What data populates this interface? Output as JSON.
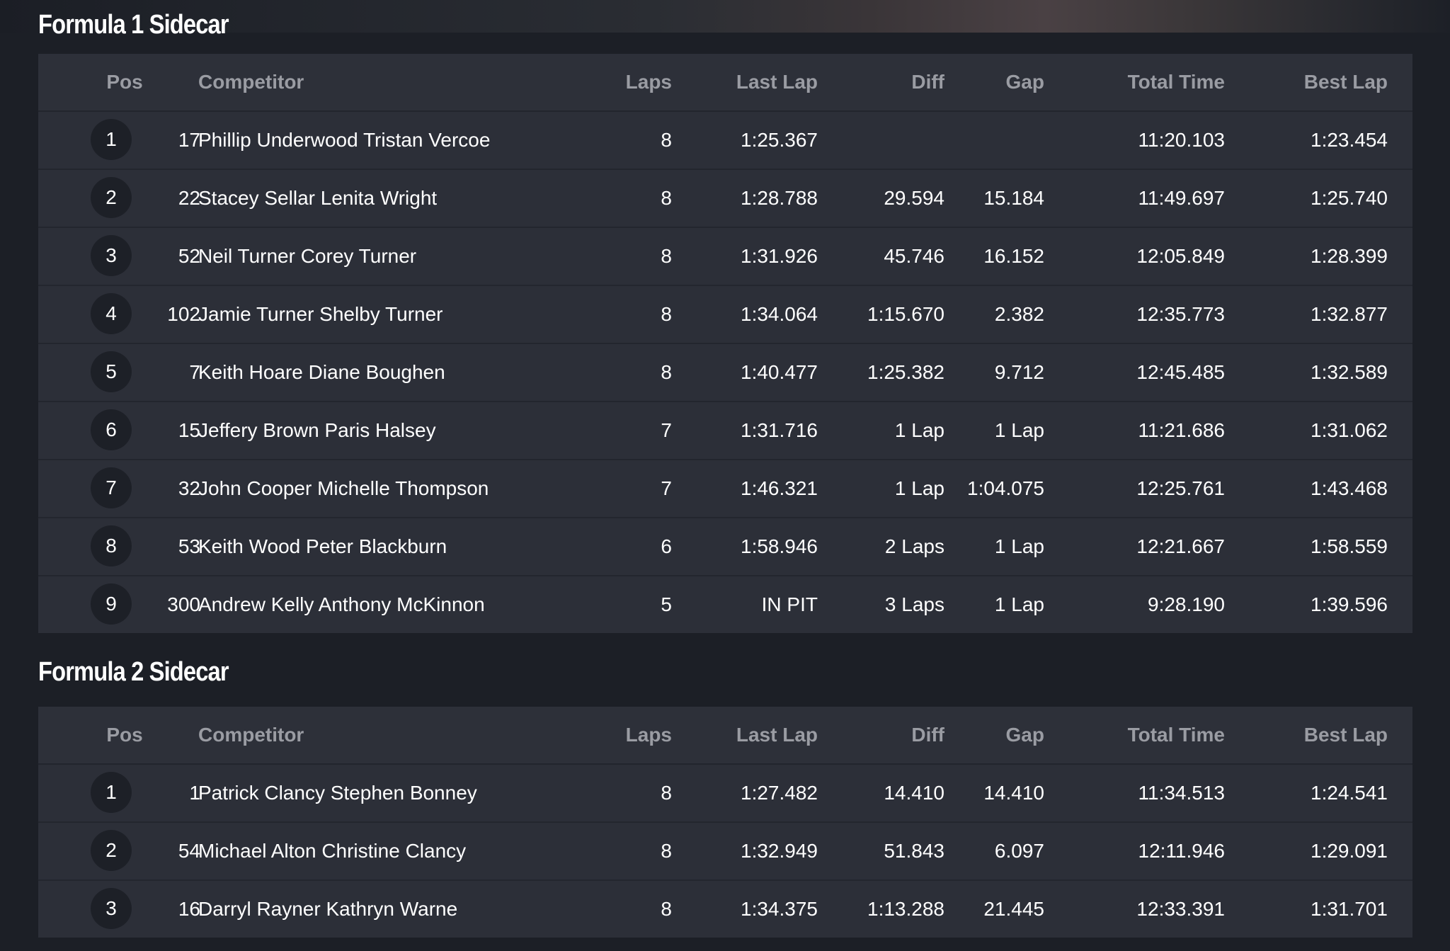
{
  "columns": {
    "pos": "Pos",
    "competitor": "Competitor",
    "laps": "Laps",
    "last_lap": "Last Lap",
    "diff": "Diff",
    "gap": "Gap",
    "total_time": "Total Time",
    "best_lap": "Best Lap"
  },
  "sections": [
    {
      "title": "Formula 1 Sidecar",
      "rows": [
        {
          "pos": "1",
          "num": "17",
          "competitor": "Phillip Underwood Tristan Vercoe",
          "laps": "8",
          "last_lap": "1:25.367",
          "diff": "",
          "gap": "",
          "total_time": "11:20.103",
          "best_lap": "1:23.454"
        },
        {
          "pos": "2",
          "num": "22",
          "competitor": "Stacey Sellar Lenita Wright",
          "laps": "8",
          "last_lap": "1:28.788",
          "diff": "29.594",
          "gap": "15.184",
          "total_time": "11:49.697",
          "best_lap": "1:25.740"
        },
        {
          "pos": "3",
          "num": "52",
          "competitor": "Neil Turner Corey Turner",
          "laps": "8",
          "last_lap": "1:31.926",
          "diff": "45.746",
          "gap": "16.152",
          "total_time": "12:05.849",
          "best_lap": "1:28.399"
        },
        {
          "pos": "4",
          "num": "102",
          "competitor": "Jamie Turner Shelby Turner",
          "laps": "8",
          "last_lap": "1:34.064",
          "diff": "1:15.670",
          "gap": "2.382",
          "total_time": "12:35.773",
          "best_lap": "1:32.877"
        },
        {
          "pos": "5",
          "num": "7",
          "competitor": "Keith Hoare Diane Boughen",
          "laps": "8",
          "last_lap": "1:40.477",
          "diff": "1:25.382",
          "gap": "9.712",
          "total_time": "12:45.485",
          "best_lap": "1:32.589"
        },
        {
          "pos": "6",
          "num": "15",
          "competitor": "Jeffery Brown Paris Halsey",
          "laps": "7",
          "last_lap": "1:31.716",
          "diff": "1 Lap",
          "gap": "1 Lap",
          "total_time": "11:21.686",
          "best_lap": "1:31.062"
        },
        {
          "pos": "7",
          "num": "32",
          "competitor": "John Cooper Michelle Thompson",
          "laps": "7",
          "last_lap": "1:46.321",
          "diff": "1 Lap",
          "gap": "1:04.075",
          "total_time": "12:25.761",
          "best_lap": "1:43.468"
        },
        {
          "pos": "8",
          "num": "53",
          "competitor": "Keith Wood Peter Blackburn",
          "laps": "6",
          "last_lap": "1:58.946",
          "diff": "2 Laps",
          "gap": "1 Lap",
          "total_time": "12:21.667",
          "best_lap": "1:58.559"
        },
        {
          "pos": "9",
          "num": "300",
          "competitor": "Andrew Kelly Anthony McKinnon",
          "laps": "5",
          "last_lap": "IN PIT",
          "diff": "3 Laps",
          "gap": "1 Lap",
          "total_time": "9:28.190",
          "best_lap": "1:39.596"
        }
      ]
    },
    {
      "title": "Formula 2 Sidecar",
      "rows": [
        {
          "pos": "1",
          "num": "1",
          "competitor": "Patrick Clancy Stephen Bonney",
          "laps": "8",
          "last_lap": "1:27.482",
          "diff": "14.410",
          "gap": "14.410",
          "total_time": "11:34.513",
          "best_lap": "1:24.541"
        },
        {
          "pos": "2",
          "num": "54",
          "competitor": "Michael Alton Christine Clancy",
          "laps": "8",
          "last_lap": "1:32.949",
          "diff": "51.843",
          "gap": "6.097",
          "total_time": "12:11.946",
          "best_lap": "1:29.091"
        },
        {
          "pos": "3",
          "num": "16",
          "competitor": "Darryl Rayner Kathryn Warne",
          "laps": "8",
          "last_lap": "1:34.375",
          "diff": "1:13.288",
          "gap": "21.445",
          "total_time": "12:33.391",
          "best_lap": "1:31.701"
        }
      ]
    }
  ],
  "colors": {
    "page_bg": "#1c1f26",
    "table_bg": "#2c2f38",
    "header_text": "#9a9ca3",
    "body_text": "#ffffff",
    "badge_bg": "#1d2027"
  }
}
